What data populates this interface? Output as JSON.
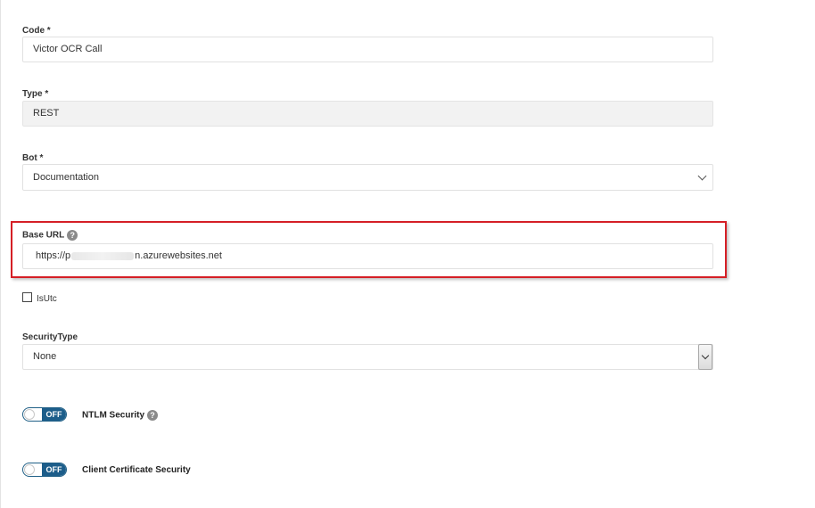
{
  "form": {
    "code": {
      "label": "Code *",
      "value": "Victor OCR Call"
    },
    "type": {
      "label": "Type *",
      "value": "REST"
    },
    "bot": {
      "label": "Bot *",
      "value": "Documentation"
    },
    "base_url": {
      "label": "Base URL",
      "help_icon": "?",
      "value_prefix": "https://p",
      "value_suffix": "n.azurewebsites.net"
    },
    "is_utc": {
      "label": "IsUtc",
      "checked": false
    },
    "security_type": {
      "label": "SecurityType",
      "value": "None"
    },
    "ntlm_security": {
      "label": "NTLM Security",
      "state": "OFF",
      "help_icon": "?"
    },
    "client_cert_security": {
      "label": "Client Certificate Security",
      "state": "OFF"
    }
  },
  "colors": {
    "highlight": "#d51f26",
    "toggle_blue": "#1c5d8a",
    "disabled_bg": "#f2f2f2"
  }
}
